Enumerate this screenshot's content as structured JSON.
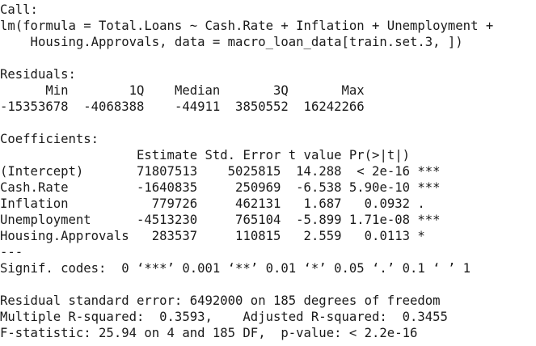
{
  "call": {
    "label": "Call:",
    "line1": "lm(formula = Total.Loans ~ Cash.Rate + Inflation + Unemployment +",
    "line2": "    Housing.Approvals, data = macro_loan_data[train.set.3, ])"
  },
  "residuals": {
    "label": "Residuals:",
    "headers": [
      "Min",
      "1Q",
      "Median",
      "3Q",
      "Max"
    ],
    "values": [
      "-15353678",
      "-4068388",
      "-44911",
      "3850552",
      "16242266"
    ]
  },
  "coefficients": {
    "label": "Coefficients:",
    "headers": [
      "Estimate",
      "Std. Error",
      "t value",
      "Pr(>|t|)"
    ],
    "rows": [
      {
        "term": "(Intercept)",
        "estimate": "71807513",
        "std_error": "5025815",
        "t_value": "14.288",
        "p_value": "< 2e-16",
        "signif": "***"
      },
      {
        "term": "Cash.Rate",
        "estimate": "-1640835",
        "std_error": "250969",
        "t_value": "-6.538",
        "p_value": "5.90e-10",
        "signif": "***"
      },
      {
        "term": "Inflation",
        "estimate": "779726",
        "std_error": "462131",
        "t_value": "1.687",
        "p_value": "0.0932",
        "signif": "."
      },
      {
        "term": "Unemployment",
        "estimate": "-4513230",
        "std_error": "765104",
        "t_value": "-5.899",
        "p_value": "1.71e-08",
        "signif": "***"
      },
      {
        "term": "Housing.Approvals",
        "estimate": "283537",
        "std_error": "110815",
        "t_value": "2.559",
        "p_value": "0.0113",
        "signif": "*"
      }
    ],
    "separator": "---",
    "signif_codes": "Signif. codes:  0 ‘***’ 0.001 ‘**’ 0.01 ‘*’ 0.05 ‘.’ 0.1 ‘ ’ 1"
  },
  "summary": {
    "residual_se": "Residual standard error: 6492000 on 185 degrees of freedom",
    "r_squared": "Multiple R-squared:  0.3593,    Adjusted R-squared:  0.3455",
    "f_statistic": "F-statistic: 25.94 on 4 and 185 DF,  p-value: < 2.2e-16"
  }
}
